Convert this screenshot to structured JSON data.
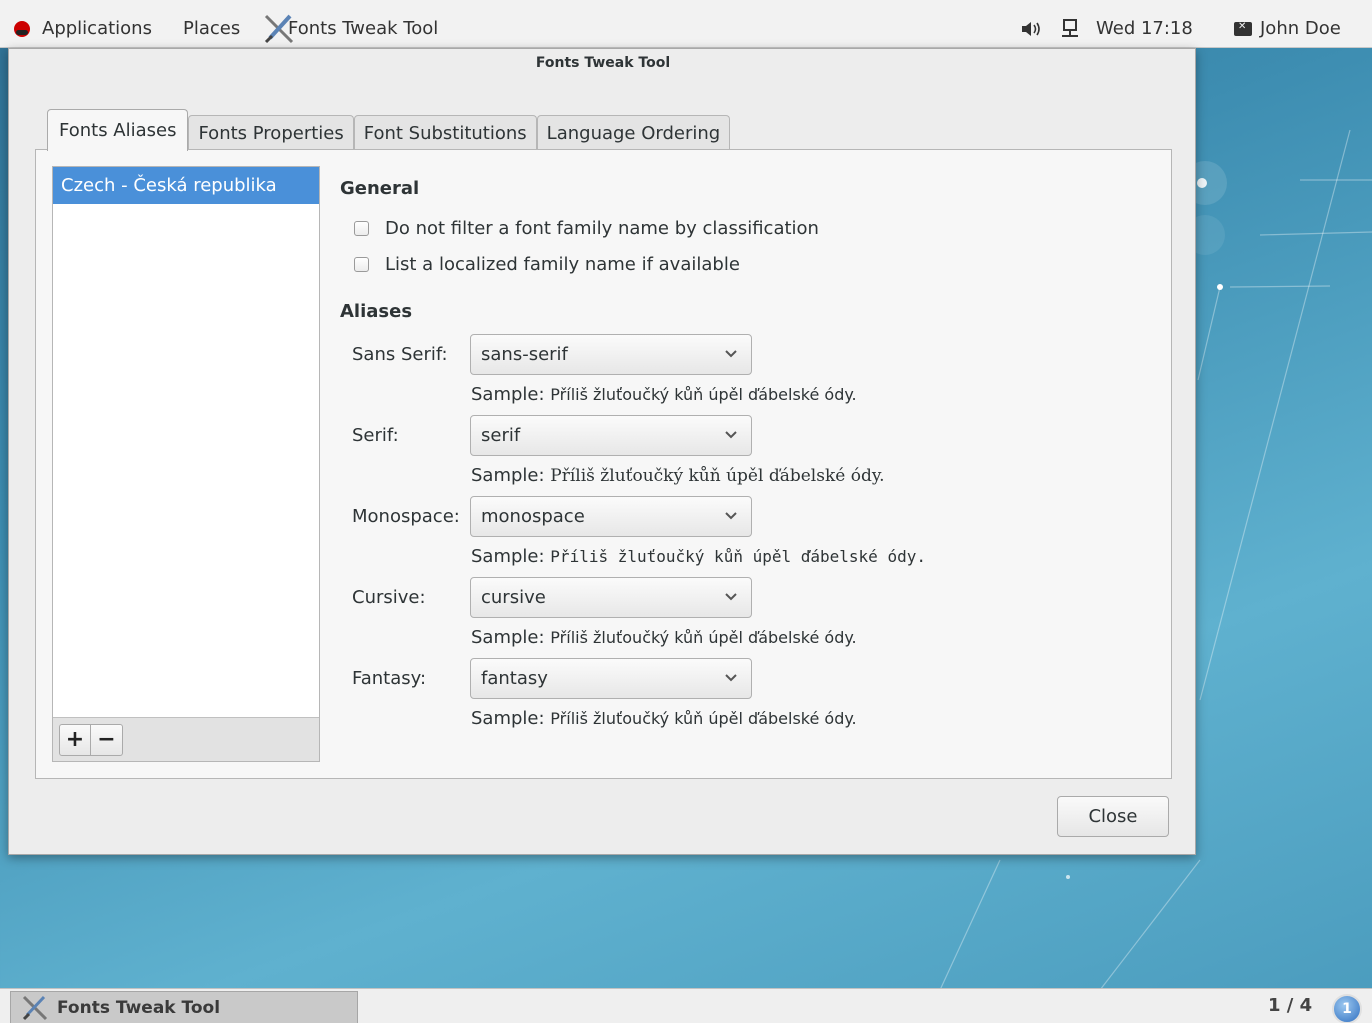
{
  "top_panel": {
    "applications": "Applications",
    "places": "Places",
    "app_name": "Fonts Tweak Tool",
    "clock": "Wed 17:18",
    "user": "John Doe"
  },
  "window": {
    "title": "Fonts Tweak Tool",
    "tabs": [
      "Fonts Aliases",
      "Fonts Properties",
      "Font Substitutions",
      "Language Ordering"
    ],
    "active_tab": "Fonts Aliases",
    "locales": [
      "Czech - Česká republika"
    ],
    "selected_locale": "Czech - Česká republika",
    "list_buttons": {
      "add": "+",
      "remove": "−"
    },
    "general": {
      "heading": "General",
      "options": [
        {
          "label": "Do not filter a font family name by classification",
          "checked": false
        },
        {
          "label": "List a localized family name if available",
          "checked": false
        }
      ]
    },
    "aliases": {
      "heading": "Aliases",
      "sample_prefix": "Sample:",
      "items": [
        {
          "label": "Sans Serif:",
          "value": "sans-serif",
          "sample": "Příliš žluťoučký kůň úpěl ďábelské ódy."
        },
        {
          "label": "Serif:",
          "value": "serif",
          "sample": "Příliš žluťoučký kůň úpěl ďábelské ódy."
        },
        {
          "label": "Monospace:",
          "value": "monospace",
          "sample": "Příliš žluťoučký kůň úpěl ďábelské ódy."
        },
        {
          "label": "Cursive:",
          "value": "cursive",
          "sample": "Příliš žluťoučký kůň úpěl ďábelské ódy."
        },
        {
          "label": "Fantasy:",
          "value": "fantasy",
          "sample": "Příliš žluťoučký kůň úpěl ďábelské ódy."
        }
      ]
    },
    "close_button": "Close"
  },
  "bottom_panel": {
    "task": "Fonts Tweak Tool",
    "workspace": "1 / 4",
    "notifications": "1"
  },
  "colors": {
    "selection": "#4a90d9",
    "desktop": "#3d8db1",
    "notification": "#2f6fc0"
  },
  "icons": {
    "apps": "redhat-icon",
    "volume": "volume-icon",
    "network": "network-icon",
    "user": "user-icon",
    "tool": "fonts-tool-icon",
    "combo": "chevron-down-icon",
    "notifications": "notification-icon"
  }
}
